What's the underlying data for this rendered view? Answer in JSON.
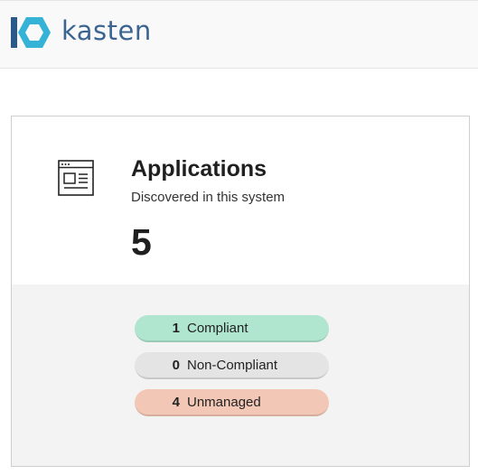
{
  "header": {
    "logo_text": "kasten",
    "colors": {
      "brand_dark": "#2a5a8c",
      "brand_light": "#34b3d6"
    }
  },
  "card": {
    "icon": "application-window-icon",
    "title": "Applications",
    "subtitle": "Discovered in this system",
    "count": "5",
    "statuses": [
      {
        "count": "1",
        "label": "Compliant",
        "color": "#b0e6cf"
      },
      {
        "count": "0",
        "label": "Non-Compliant",
        "color": "#e4e4e4"
      },
      {
        "count": "4",
        "label": "Unmanaged",
        "color": "#f3c7b6"
      }
    ]
  }
}
